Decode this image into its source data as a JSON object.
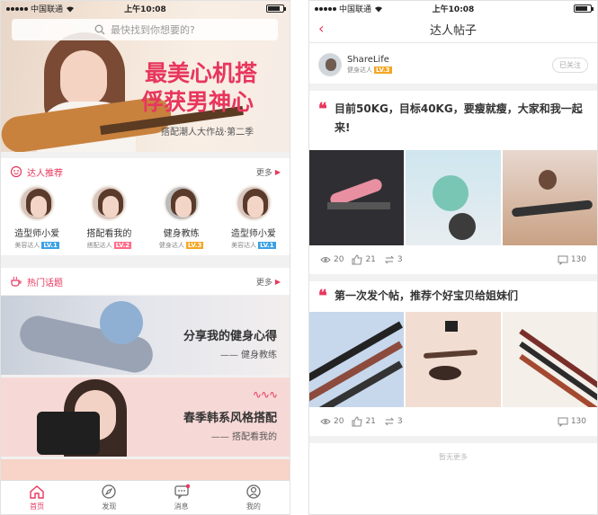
{
  "status_bar": {
    "carrier": "中国联通",
    "time": "上午10:08"
  },
  "left": {
    "search": {
      "placeholder": "最快找到你想要的?"
    },
    "banner": {
      "title_line1": "最美心机搭",
      "title_line2": "俘获男神心",
      "subtitle": "搭配潮人大作战·第二季"
    },
    "experts_section": {
      "title": "达人推荐",
      "more": "更多"
    },
    "experts": [
      {
        "name": "造型师小爱",
        "role": "美容达人",
        "level": "LV.1",
        "level_color": "#3ba0e6"
      },
      {
        "name": "搭配看我的",
        "role": "搭配达人",
        "level": "LV.2",
        "level_color": "#ff6a86"
      },
      {
        "name": "健身教练",
        "role": "健身达人",
        "level": "LV.3",
        "level_color": "#f5a623"
      },
      {
        "name": "造型师小爱",
        "role": "美容达人",
        "level": "LV.1",
        "level_color": "#3ba0e6"
      }
    ],
    "topics_section": {
      "title": "热门话题",
      "more": "更多"
    },
    "topics": [
      {
        "title": "分享我的健身心得",
        "sub": "—— 健身教练"
      },
      {
        "title": "春季韩系风格搭配",
        "sub": "—— 搭配看我的"
      }
    ],
    "tabbar": [
      {
        "label": "首页",
        "icon": "home-icon",
        "active": true
      },
      {
        "label": "发现",
        "icon": "compass-icon",
        "active": false
      },
      {
        "label": "消息",
        "icon": "message-icon",
        "active": false
      },
      {
        "label": "我的",
        "icon": "profile-icon",
        "active": false
      }
    ]
  },
  "right": {
    "nav": {
      "title": "达人帖子",
      "back_icon": "chevron-left-icon"
    },
    "author": {
      "name": "ShareLife",
      "role": "健身达人",
      "level": "LV.3",
      "follow": "已关注"
    },
    "posts": [
      {
        "text": "目前50KG，目标40KG，要瘦就瘦，大家和我一起来!",
        "views": "20",
        "likes": "21",
        "shares": "3",
        "comments": "130"
      },
      {
        "text": "第一次发个帖，推荐个好宝贝给姐妹们",
        "views": "20",
        "likes": "21",
        "shares": "3",
        "comments": "130"
      }
    ],
    "no_more": "暂无更多"
  },
  "colors": {
    "accent": "#e8365d",
    "background": "#f1f1f1"
  }
}
